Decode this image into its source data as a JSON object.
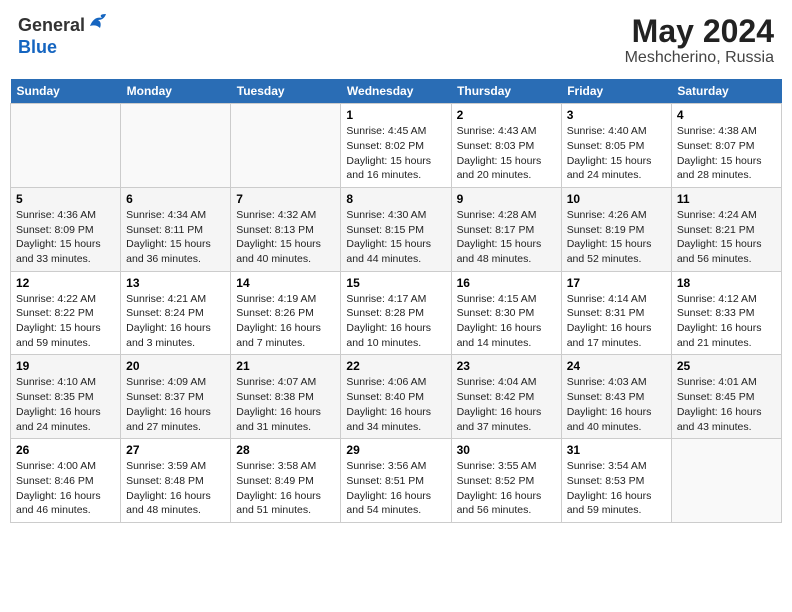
{
  "header": {
    "logo_general": "General",
    "logo_blue": "Blue",
    "month": "May 2024",
    "location": "Meshcherino, Russia"
  },
  "days_of_week": [
    "Sunday",
    "Monday",
    "Tuesday",
    "Wednesday",
    "Thursday",
    "Friday",
    "Saturday"
  ],
  "weeks": [
    [
      {
        "day": "",
        "content": ""
      },
      {
        "day": "",
        "content": ""
      },
      {
        "day": "",
        "content": ""
      },
      {
        "day": "1",
        "content": "Sunrise: 4:45 AM\nSunset: 8:02 PM\nDaylight: 15 hours\nand 16 minutes."
      },
      {
        "day": "2",
        "content": "Sunrise: 4:43 AM\nSunset: 8:03 PM\nDaylight: 15 hours\nand 20 minutes."
      },
      {
        "day": "3",
        "content": "Sunrise: 4:40 AM\nSunset: 8:05 PM\nDaylight: 15 hours\nand 24 minutes."
      },
      {
        "day": "4",
        "content": "Sunrise: 4:38 AM\nSunset: 8:07 PM\nDaylight: 15 hours\nand 28 minutes."
      }
    ],
    [
      {
        "day": "5",
        "content": "Sunrise: 4:36 AM\nSunset: 8:09 PM\nDaylight: 15 hours\nand 33 minutes."
      },
      {
        "day": "6",
        "content": "Sunrise: 4:34 AM\nSunset: 8:11 PM\nDaylight: 15 hours\nand 36 minutes."
      },
      {
        "day": "7",
        "content": "Sunrise: 4:32 AM\nSunset: 8:13 PM\nDaylight: 15 hours\nand 40 minutes."
      },
      {
        "day": "8",
        "content": "Sunrise: 4:30 AM\nSunset: 8:15 PM\nDaylight: 15 hours\nand 44 minutes."
      },
      {
        "day": "9",
        "content": "Sunrise: 4:28 AM\nSunset: 8:17 PM\nDaylight: 15 hours\nand 48 minutes."
      },
      {
        "day": "10",
        "content": "Sunrise: 4:26 AM\nSunset: 8:19 PM\nDaylight: 15 hours\nand 52 minutes."
      },
      {
        "day": "11",
        "content": "Sunrise: 4:24 AM\nSunset: 8:21 PM\nDaylight: 15 hours\nand 56 minutes."
      }
    ],
    [
      {
        "day": "12",
        "content": "Sunrise: 4:22 AM\nSunset: 8:22 PM\nDaylight: 15 hours\nand 59 minutes."
      },
      {
        "day": "13",
        "content": "Sunrise: 4:21 AM\nSunset: 8:24 PM\nDaylight: 16 hours\nand 3 minutes."
      },
      {
        "day": "14",
        "content": "Sunrise: 4:19 AM\nSunset: 8:26 PM\nDaylight: 16 hours\nand 7 minutes."
      },
      {
        "day": "15",
        "content": "Sunrise: 4:17 AM\nSunset: 8:28 PM\nDaylight: 16 hours\nand 10 minutes."
      },
      {
        "day": "16",
        "content": "Sunrise: 4:15 AM\nSunset: 8:30 PM\nDaylight: 16 hours\nand 14 minutes."
      },
      {
        "day": "17",
        "content": "Sunrise: 4:14 AM\nSunset: 8:31 PM\nDaylight: 16 hours\nand 17 minutes."
      },
      {
        "day": "18",
        "content": "Sunrise: 4:12 AM\nSunset: 8:33 PM\nDaylight: 16 hours\nand 21 minutes."
      }
    ],
    [
      {
        "day": "19",
        "content": "Sunrise: 4:10 AM\nSunset: 8:35 PM\nDaylight: 16 hours\nand 24 minutes."
      },
      {
        "day": "20",
        "content": "Sunrise: 4:09 AM\nSunset: 8:37 PM\nDaylight: 16 hours\nand 27 minutes."
      },
      {
        "day": "21",
        "content": "Sunrise: 4:07 AM\nSunset: 8:38 PM\nDaylight: 16 hours\nand 31 minutes."
      },
      {
        "day": "22",
        "content": "Sunrise: 4:06 AM\nSunset: 8:40 PM\nDaylight: 16 hours\nand 34 minutes."
      },
      {
        "day": "23",
        "content": "Sunrise: 4:04 AM\nSunset: 8:42 PM\nDaylight: 16 hours\nand 37 minutes."
      },
      {
        "day": "24",
        "content": "Sunrise: 4:03 AM\nSunset: 8:43 PM\nDaylight: 16 hours\nand 40 minutes."
      },
      {
        "day": "25",
        "content": "Sunrise: 4:01 AM\nSunset: 8:45 PM\nDaylight: 16 hours\nand 43 minutes."
      }
    ],
    [
      {
        "day": "26",
        "content": "Sunrise: 4:00 AM\nSunset: 8:46 PM\nDaylight: 16 hours\nand 46 minutes."
      },
      {
        "day": "27",
        "content": "Sunrise: 3:59 AM\nSunset: 8:48 PM\nDaylight: 16 hours\nand 48 minutes."
      },
      {
        "day": "28",
        "content": "Sunrise: 3:58 AM\nSunset: 8:49 PM\nDaylight: 16 hours\nand 51 minutes."
      },
      {
        "day": "29",
        "content": "Sunrise: 3:56 AM\nSunset: 8:51 PM\nDaylight: 16 hours\nand 54 minutes."
      },
      {
        "day": "30",
        "content": "Sunrise: 3:55 AM\nSunset: 8:52 PM\nDaylight: 16 hours\nand 56 minutes."
      },
      {
        "day": "31",
        "content": "Sunrise: 3:54 AM\nSunset: 8:53 PM\nDaylight: 16 hours\nand 59 minutes."
      },
      {
        "day": "",
        "content": ""
      }
    ]
  ]
}
